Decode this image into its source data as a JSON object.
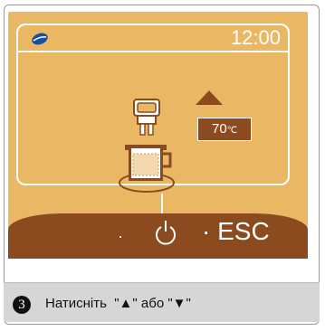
{
  "display": {
    "time": "12:00",
    "temperature_value": "70",
    "temperature_unit": "℃",
    "esc_label": "· ESC",
    "left_dot": "·"
  },
  "instruction": {
    "step_number": "3",
    "text": "Натисніть  \"▲\" або \"▼\""
  },
  "colors": {
    "panel": "#eab865",
    "bar": "#8b4b1f",
    "bean_icon": "#1a4ea1"
  }
}
